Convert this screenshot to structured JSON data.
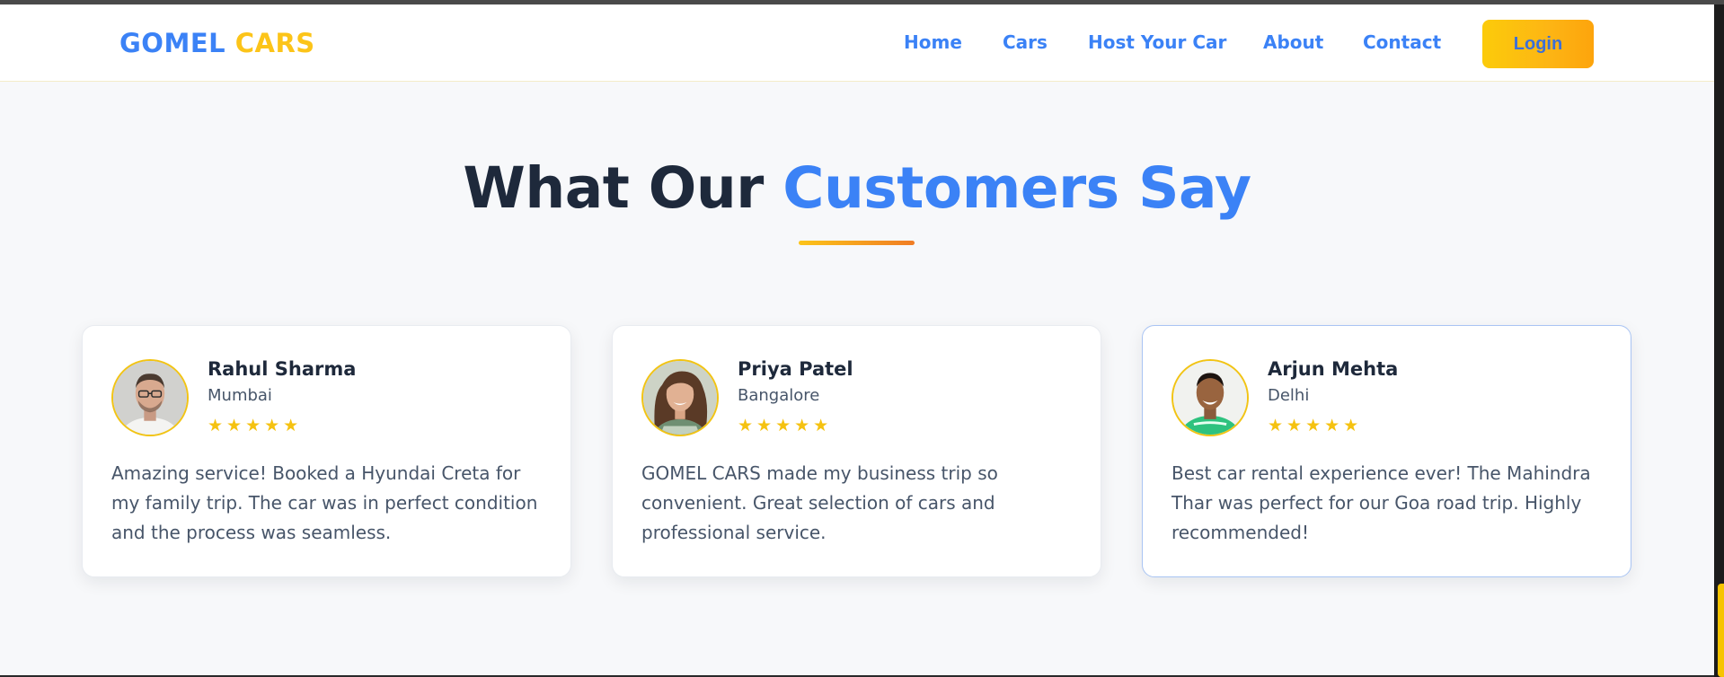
{
  "brand": {
    "word1": "GOMEL",
    "word2": "CARS"
  },
  "nav": {
    "links": [
      "Home",
      "Cars",
      "Host Your Car",
      "About",
      "Contact"
    ],
    "login_label": "Login"
  },
  "section": {
    "title_part1": "What Our",
    "title_part2": "Customers Say"
  },
  "testimonials": [
    {
      "name": "Rahul Sharma",
      "city": "Mumbai",
      "rating": 5,
      "stars": "★★★★★",
      "quote": "Amazing service! Booked a Hyundai Creta for my family trip. The car was in perfect condition and the process was seamless."
    },
    {
      "name": "Priya Patel",
      "city": "Bangalore",
      "rating": 5,
      "stars": "★★★★★",
      "quote": "GOMEL CARS made my business trip so convenient. Great selection of cars and professional service."
    },
    {
      "name": "Arjun Mehta",
      "city": "Delhi",
      "rating": 5,
      "stars": "★★★★★",
      "quote": "Best car rental experience ever! The Mahindra Thar was perfect for our Goa road trip. Highly recommended!"
    }
  ],
  "colors": {
    "primary": "#3b82f6",
    "accent": "#fcc419",
    "heading": "#1e293b",
    "star": "#f5c211"
  }
}
